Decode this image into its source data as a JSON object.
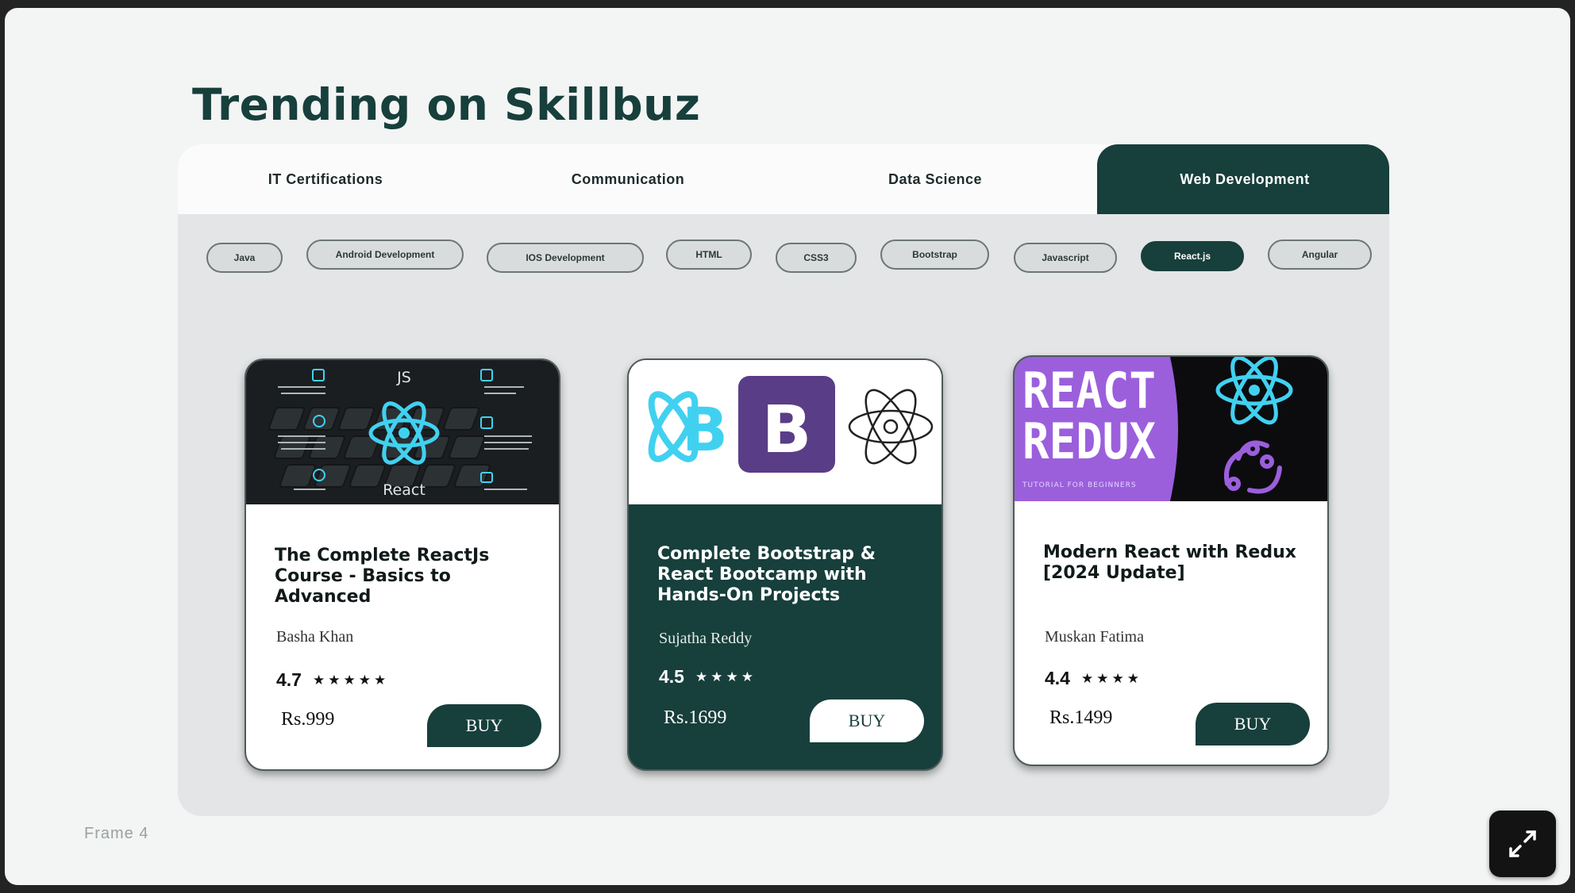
{
  "title": "Trending on Skillbuz",
  "tabs": [
    {
      "label": "IT Certifications"
    },
    {
      "label": "Communication"
    },
    {
      "label": "Data Science"
    },
    {
      "label": "Web Development",
      "active": true
    }
  ],
  "chips": [
    {
      "label": "Java"
    },
    {
      "label": "Android Development"
    },
    {
      "label": "IOS Development"
    },
    {
      "label": "HTML"
    },
    {
      "label": "CSS3"
    },
    {
      "label": "Bootstrap"
    },
    {
      "label": "Javascript"
    },
    {
      "label": "React.js",
      "active": true
    },
    {
      "label": "Angular"
    }
  ],
  "cards": [
    {
      "thumb_icon": "react-keyboard-thumbnail",
      "thumb_top_text": "JS",
      "thumb_caption": "React",
      "title": "The Complete ReactJs Course - Basics to Advanced",
      "author": "Basha Khan",
      "rating": "4.7",
      "stars": "★★★★★",
      "price": "Rs.999",
      "buy_label": "BUY",
      "theme": "light"
    },
    {
      "thumb_icon": "react-bootstrap-thumbnail",
      "thumb_text": "B",
      "title": "Complete Bootstrap & React Bootcamp with Hands-On Projects",
      "author": "Sujatha Reddy",
      "rating": "4.5",
      "stars": "★★★★",
      "price": "Rs.1699",
      "buy_label": "BUY",
      "theme": "dark"
    },
    {
      "thumb_icon": "react-redux-thumbnail",
      "thumb_line1": "REACT",
      "thumb_line2": "REDUX",
      "thumb_tagline": "TUTORIAL FOR BEGINNERS",
      "title": "Modern React with Redux [2024 Update]",
      "author": "Muskan Fatima",
      "rating": "4.4",
      "stars": "★★★★",
      "price": "Rs.1499",
      "buy_label": "BUY",
      "theme": "light"
    }
  ],
  "frame_label": "Frame 4",
  "colors": {
    "brand": "#173f3c",
    "react_cyan": "#41d1f0",
    "bootstrap_purple": "#5a3d87",
    "redux_purple": "#9b5fdc"
  },
  "expand_icon": "expand-arrows-icon"
}
